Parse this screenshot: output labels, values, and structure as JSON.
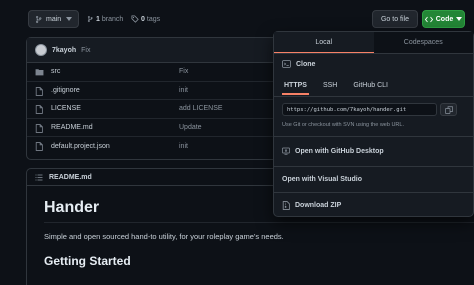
{
  "toolbar": {
    "branch": "main",
    "branches_count": "1",
    "branches_label": "branch",
    "tags_count": "0",
    "tags_label": "tags",
    "goto_file": "Go to file",
    "code": "Code"
  },
  "commit": {
    "author": "7kayoh",
    "message": "Fix"
  },
  "files": [
    {
      "name": "src",
      "commit": "Fix",
      "type": "folder"
    },
    {
      "name": ".gitignore",
      "commit": "init",
      "type": "file"
    },
    {
      "name": "LICENSE",
      "commit": "add LICENSE",
      "type": "file"
    },
    {
      "name": "README.md",
      "commit": "Update",
      "type": "file"
    },
    {
      "name": "default.project.json",
      "commit": "init",
      "type": "file"
    }
  ],
  "readme": {
    "filename": "README.md",
    "title": "Hander",
    "description": "Simple and open sourced hand-to utility, for your roleplay game's needs.",
    "getting_started": "Getting Started"
  },
  "clone_menu": {
    "tab_local": "Local",
    "tab_codespaces": "Codespaces",
    "clone_label": "Clone",
    "protocols": [
      "HTTPS",
      "SSH",
      "GitHub CLI"
    ],
    "url": "https://github.com/7kayoh/hander.git",
    "hint": "Use Git or checkout with SVN using the web URL.",
    "open_desktop": "Open with GitHub Desktop",
    "open_vs": "Open with Visual Studio",
    "download_zip": "Download ZIP"
  },
  "colors": {
    "background": "#0d1117",
    "code_button": "#238636",
    "active_tab_underline": "#f78166",
    "folder_icon": "#7d8590"
  }
}
